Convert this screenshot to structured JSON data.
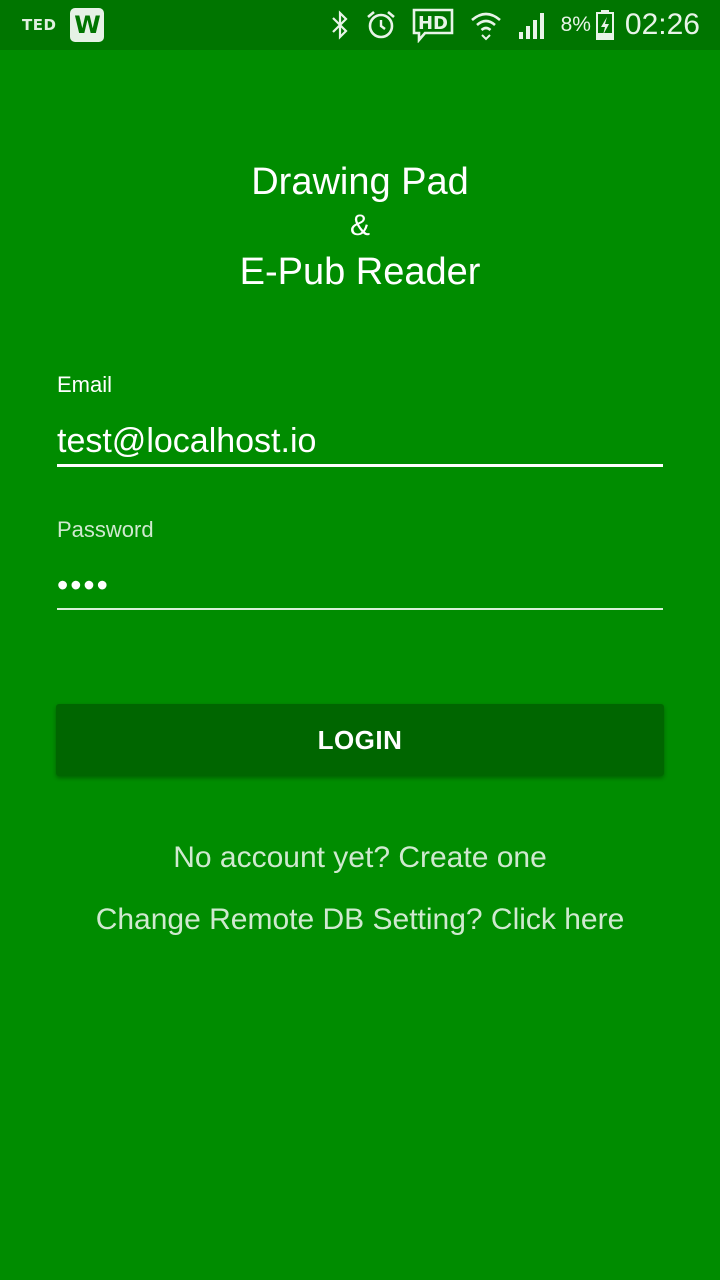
{
  "status_bar": {
    "left_app_label": "TED",
    "left_app2_label": "W",
    "icons": [
      "bluetooth-icon",
      "alarm-icon",
      "hd-voice-icon",
      "wifi-icon",
      "signal-icon",
      "battery-charging-icon"
    ],
    "battery_percent": "8%",
    "time": "02:26"
  },
  "app": {
    "title_line1": "Drawing Pad",
    "title_line2": "&",
    "title_line3": "E-Pub Reader"
  },
  "form": {
    "email_label": "Email",
    "email_value": "test@localhost.io",
    "password_label": "Password",
    "password_value": "••••",
    "login_label": "LOGIN"
  },
  "links": {
    "create_account": "No account yet? Create one",
    "remote_db": "Change Remote DB Setting? Click here"
  },
  "colors": {
    "background": "#008c00",
    "status_bar": "#007500",
    "button": "#006600",
    "link_text": "#cfe9cf"
  }
}
